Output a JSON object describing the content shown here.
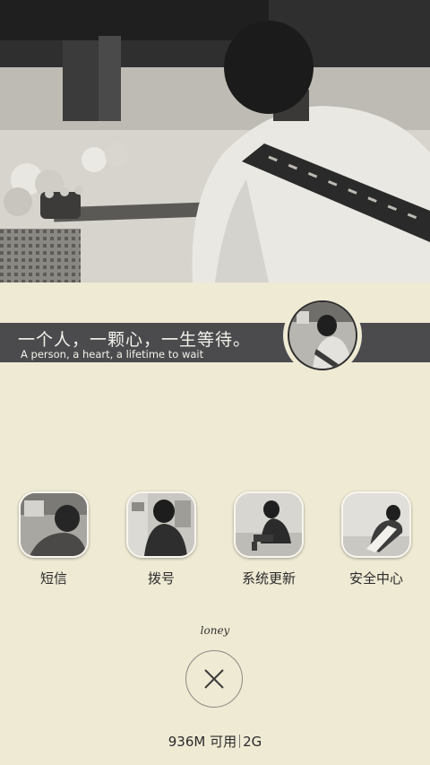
{
  "banner": {
    "quote_cn": "一个人，一颗心，一生等待。",
    "quote_en": "A person, a heart, a lifetime to wait"
  },
  "apps": [
    {
      "label": "短信",
      "icon": "messages-icon"
    },
    {
      "label": "拨号",
      "icon": "dialer-icon"
    },
    {
      "label": "系统更新",
      "icon": "system-update-icon"
    },
    {
      "label": "安全中心",
      "icon": "security-center-icon"
    }
  ],
  "signature": "loney",
  "memory": {
    "available": "936M 可用",
    "total": "2G"
  },
  "colors": {
    "background": "#efead4",
    "banner": "#4b4b4e",
    "text": "#2b2b2b"
  }
}
